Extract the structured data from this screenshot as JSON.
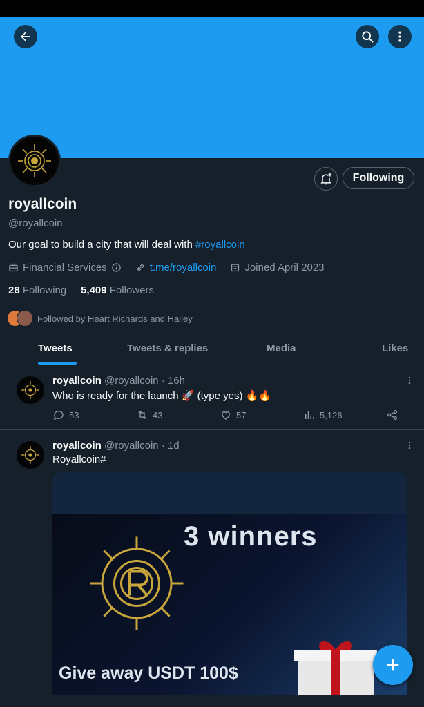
{
  "profile": {
    "name": "royallcoin",
    "handle": "@royallcoin",
    "bio_text": "Our goal to build a city that will deal with ",
    "bio_tag": "#royallcoin",
    "category": "Financial Services",
    "link": "t.me/royallcoin",
    "joined": "Joined April 2023",
    "following_count": "28",
    "following_label": "Following",
    "followers_count": "5,409",
    "followers_label": "Followers",
    "followed_by": "Followed by Heart Richards and Hailey",
    "follow_button": "Following"
  },
  "tabs": [
    "Tweets",
    "Tweets & replies",
    "Media",
    "Likes"
  ],
  "tweets": [
    {
      "name": "royallcoin",
      "meta": "@royallcoin · 16h",
      "text": "Who is ready for the launch 🚀 (type yes) 🔥🔥",
      "replies": "53",
      "retweets": "43",
      "likes": "57",
      "views": "5,126"
    },
    {
      "name": "royallcoin",
      "meta": "@royallcoin · 1d",
      "text": "Royallcoin#",
      "media_title": "3 winners",
      "media_caption": "Give away USDT 100$"
    }
  ],
  "colors": {
    "accent": "#1d9bf0",
    "background": "#15202b",
    "muted": "#8b98a5"
  },
  "icons": [
    "back-arrow-icon",
    "search-icon",
    "more-vertical-icon",
    "bell-plus-icon",
    "briefcase-icon",
    "info-icon",
    "link-icon",
    "calendar-icon",
    "reply-icon",
    "retweet-icon",
    "like-icon",
    "views-icon",
    "share-icon",
    "compose-plus-icon"
  ]
}
